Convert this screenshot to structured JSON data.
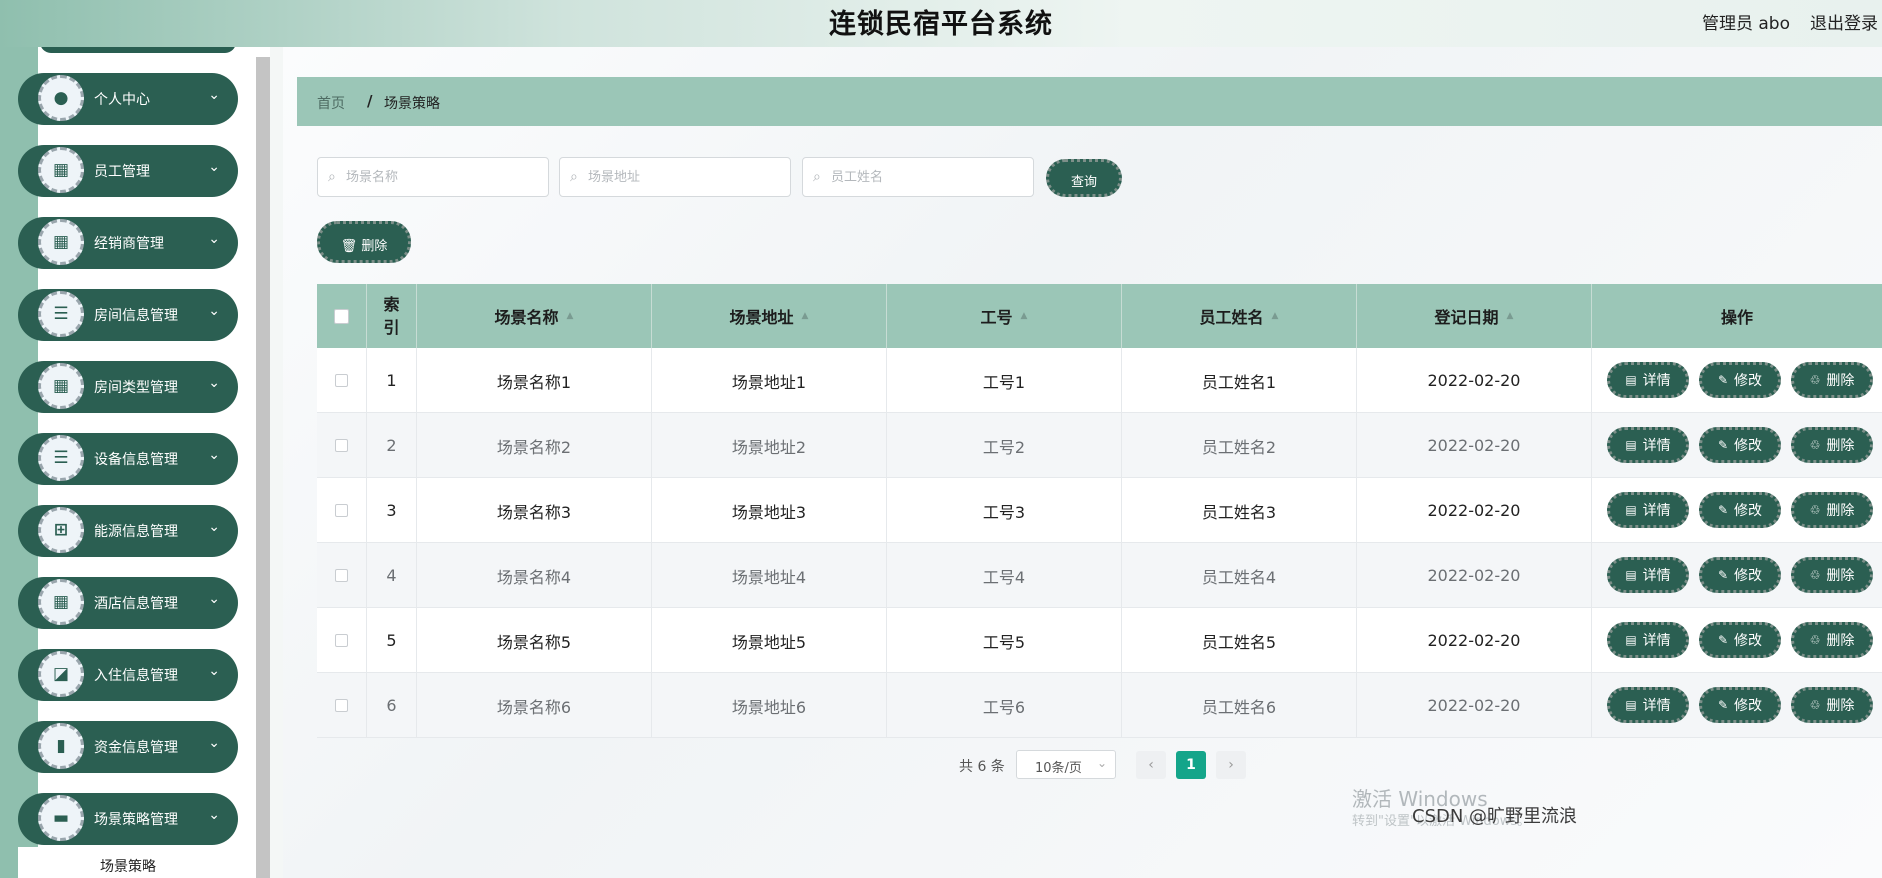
{
  "header": {
    "title": "连锁民宿平台系统",
    "user": "管理员 abo",
    "logout": "退出登录"
  },
  "sidebar": {
    "items": [
      {
        "label": "个人中心",
        "icon": "user-icon",
        "glyph": "●"
      },
      {
        "label": "员工管理",
        "icon": "grid-icon",
        "glyph": "▦"
      },
      {
        "label": "经销商管理",
        "icon": "grid-icon",
        "glyph": "▦"
      },
      {
        "label": "房间信息管理",
        "icon": "list-icon",
        "glyph": "☰"
      },
      {
        "label": "房间类型管理",
        "icon": "grid-icon",
        "glyph": "▦"
      },
      {
        "label": "设备信息管理",
        "icon": "list-icon",
        "glyph": "☰"
      },
      {
        "label": "能源信息管理",
        "icon": "apps-icon",
        "glyph": "⊞"
      },
      {
        "label": "酒店信息管理",
        "icon": "grid-icon",
        "glyph": "▦"
      },
      {
        "label": "入住信息管理",
        "icon": "chart-line-icon",
        "glyph": "◪"
      },
      {
        "label": "资金信息管理",
        "icon": "bar-chart-icon",
        "glyph": "▮"
      },
      {
        "label": "场景策略管理",
        "icon": "tray-icon",
        "glyph": "▬"
      }
    ],
    "chevron": "⌄",
    "submenu_label": "场景策略"
  },
  "breadcrumb": {
    "home": "首页",
    "separator": "/",
    "current": "场景策略"
  },
  "search": {
    "scene_name_placeholder": "场景名称",
    "scene_address_placeholder": "场景地址",
    "employee_name_placeholder": "员工姓名",
    "query_label": "查询",
    "delete_label": "删除"
  },
  "table": {
    "headers": {
      "index": "索引",
      "scene_name": "场景名称",
      "scene_address": "场景地址",
      "job_no": "工号",
      "employee_name": "员工姓名",
      "reg_date": "登记日期",
      "actions": "操作"
    },
    "rows": [
      {
        "index": "1",
        "scene_name": "场景名称1",
        "scene_address": "场景地址1",
        "job_no": "工号1",
        "employee_name": "员工姓名1",
        "reg_date": "2022-02-20"
      },
      {
        "index": "2",
        "scene_name": "场景名称2",
        "scene_address": "场景地址2",
        "job_no": "工号2",
        "employee_name": "员工姓名2",
        "reg_date": "2022-02-20"
      },
      {
        "index": "3",
        "scene_name": "场景名称3",
        "scene_address": "场景地址3",
        "job_no": "工号3",
        "employee_name": "员工姓名3",
        "reg_date": "2022-02-20"
      },
      {
        "index": "4",
        "scene_name": "场景名称4",
        "scene_address": "场景地址4",
        "job_no": "工号4",
        "employee_name": "员工姓名4",
        "reg_date": "2022-02-20"
      },
      {
        "index": "5",
        "scene_name": "场景名称5",
        "scene_address": "场景地址5",
        "job_no": "工号5",
        "employee_name": "员工姓名5",
        "reg_date": "2022-02-20"
      },
      {
        "index": "6",
        "scene_name": "场景名称6",
        "scene_address": "场景地址6",
        "job_no": "工号6",
        "employee_name": "员工姓名6",
        "reg_date": "2022-02-20"
      }
    ],
    "row_actions": {
      "detail": "详情",
      "edit": "修改",
      "delete": "删除"
    }
  },
  "pagination": {
    "total": "共 6 条",
    "page_size": "10条/页",
    "current_page": "1",
    "prev": "‹",
    "next": "›"
  },
  "watermarks": {
    "activate_windows": "激活 Windows",
    "activate_hint": "转到\"设置\"以激活 Windows。",
    "csdn": "CSDN @旷野里流浪"
  },
  "colors": {
    "accent_dark": "#2b5f52",
    "accent_light": "#9bc6b7",
    "page_active": "#14a58a"
  }
}
